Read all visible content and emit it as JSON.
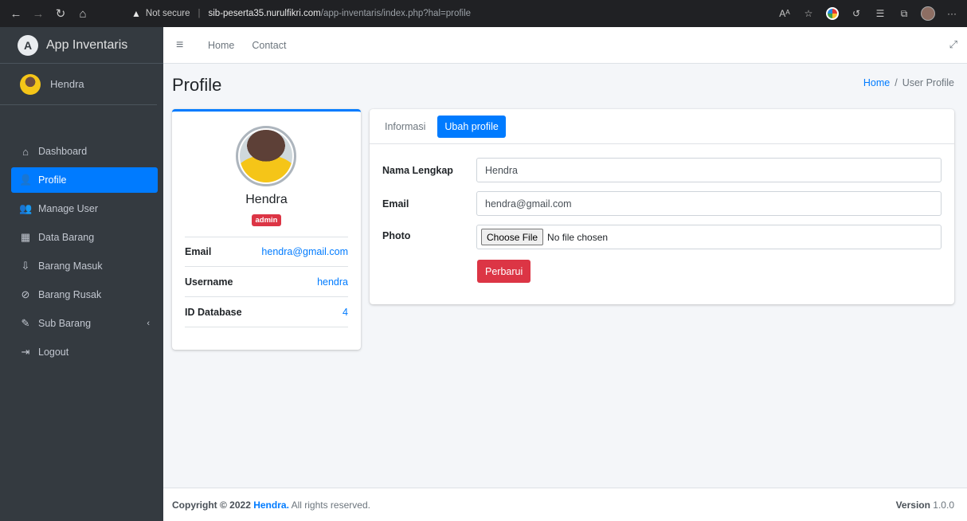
{
  "browser": {
    "warning_text": "Not secure",
    "url_main": "sib-peserta35.nurulfikri.com",
    "url_path": "/app-inventaris/index.php?hal=profile"
  },
  "sidebar": {
    "brand": "App Inventaris",
    "brand_logo": "A",
    "user_name": "Hendra",
    "items": [
      {
        "label": "Dashboard",
        "icon": "⌂"
      },
      {
        "label": "Profile",
        "icon": "👤"
      },
      {
        "label": "Manage User",
        "icon": "👥"
      },
      {
        "label": "Data Barang",
        "icon": "▦"
      },
      {
        "label": "Barang Masuk",
        "icon": "⇩"
      },
      {
        "label": "Barang Rusak",
        "icon": "⊘"
      },
      {
        "label": "Sub Barang",
        "icon": "✎",
        "chevron": "‹"
      },
      {
        "label": "Logout",
        "icon": "⇥"
      }
    ]
  },
  "topnav": {
    "menu_icon": "≡",
    "links": [
      "Home",
      "Contact"
    ],
    "expand_icon": "⤢"
  },
  "page": {
    "title": "Profile",
    "breadcrumb": {
      "home": "Home",
      "separator": "/",
      "current": "User Profile"
    }
  },
  "profile_card": {
    "name": "Hendra",
    "badge": "admin",
    "rows": [
      {
        "key": "Email",
        "value": "hendra@gmail.com"
      },
      {
        "key": "Username",
        "value": "hendra"
      },
      {
        "key": "ID Database",
        "value": "4"
      }
    ]
  },
  "form": {
    "tabs": [
      {
        "label": "Informasi",
        "active": false
      },
      {
        "label": "Ubah profile",
        "active": true
      }
    ],
    "fields": [
      {
        "label": "Nama Lengkap",
        "value": "Hendra"
      },
      {
        "label": "Email",
        "value": "hendra@gmail.com"
      },
      {
        "label": "Photo",
        "button": "Choose File",
        "status": "No file chosen"
      }
    ],
    "submit_label": "Perbarui"
  },
  "footer": {
    "copyright_prefix": "Copyright © 2022",
    "brand": "Hendra.",
    "suffix": "All rights reserved.",
    "version_label": "Version",
    "version": "1.0.0"
  },
  "colors": {
    "primary": "#007bff",
    "danger": "#dc3545",
    "sidebar_bg": "#343a40"
  }
}
